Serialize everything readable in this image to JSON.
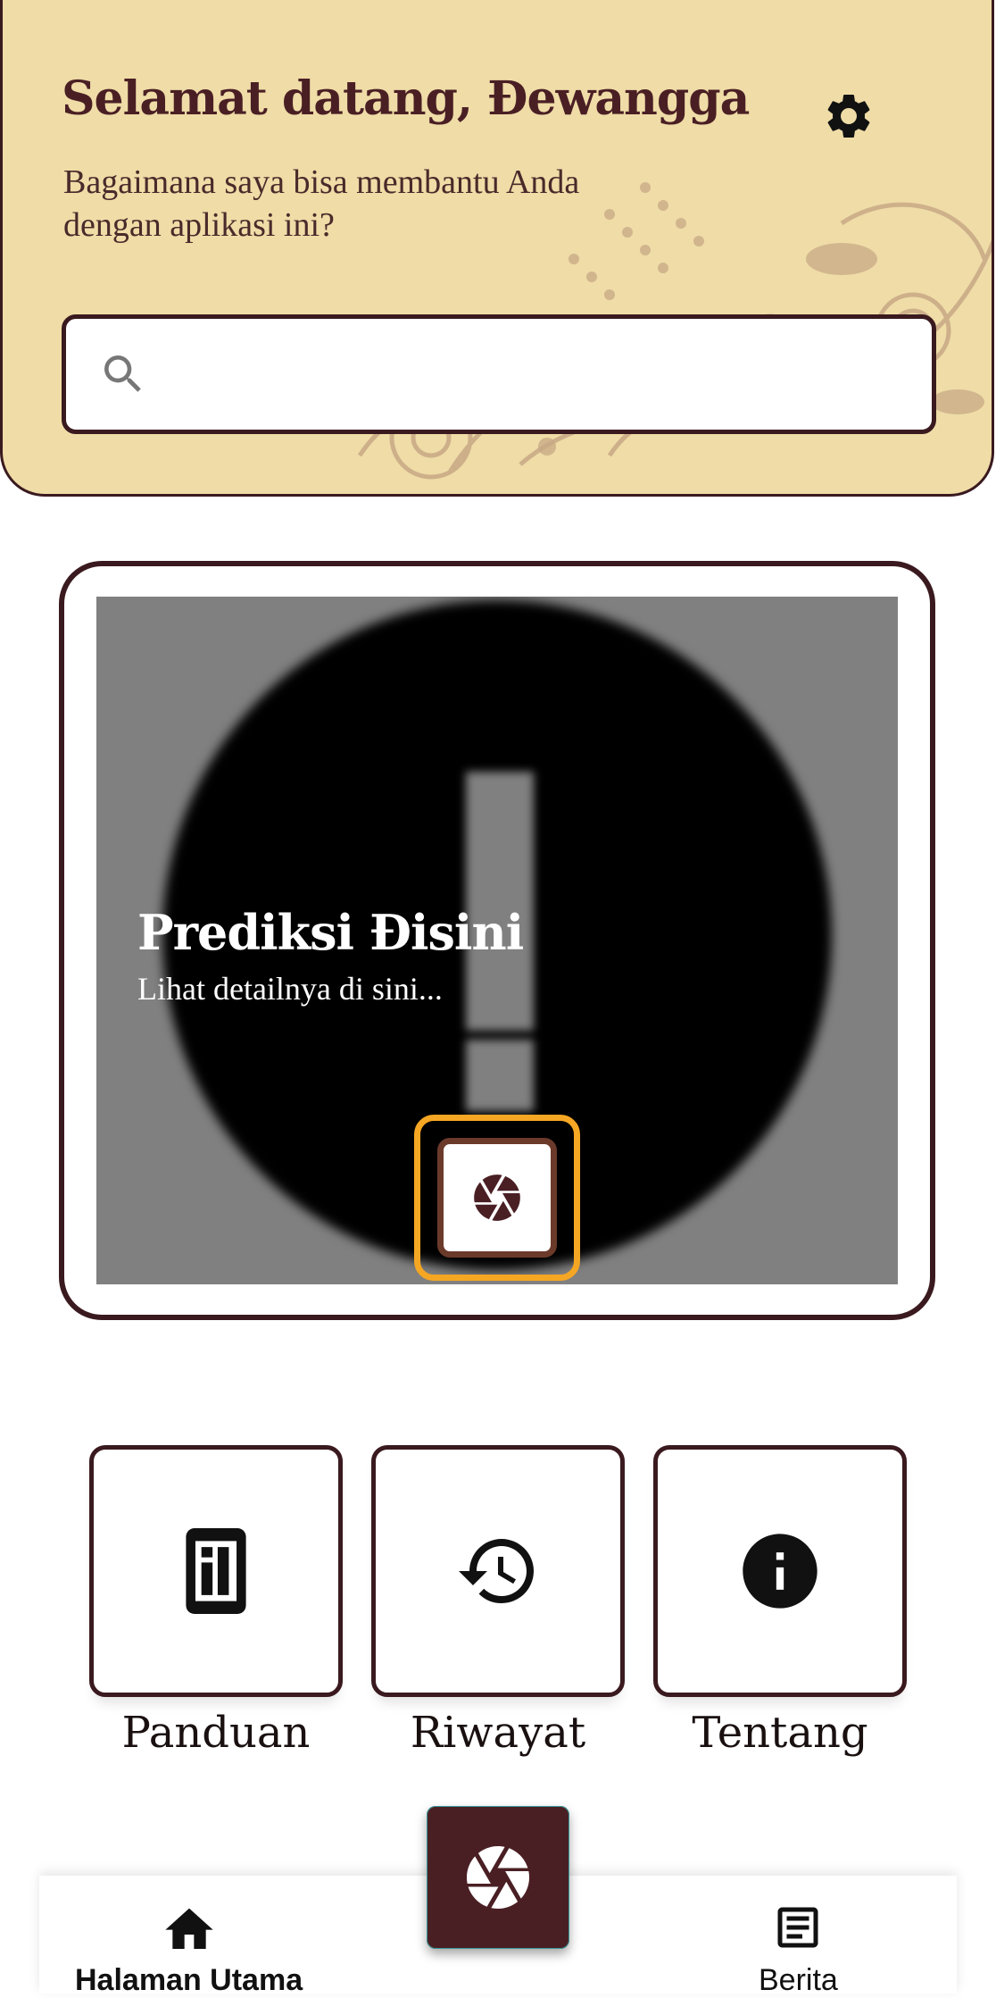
{
  "header": {
    "greeting": "Selamat datang, Đewangga",
    "subtitle": "Bagaimana saya bisa membantu Anda dengan aplikasi ini?",
    "settings_icon": "gear-icon"
  },
  "search": {
    "placeholder": "",
    "value": "",
    "icon": "search-icon"
  },
  "prediction": {
    "title": "Prediksi Đisini",
    "subtitle": "Lihat detailnya di sini...",
    "image_icon": "error-icon",
    "camera_icon": "camera-aperture-icon"
  },
  "menu": [
    {
      "label": "Panduan",
      "icon": "guide-icon"
    },
    {
      "label": "Riwayat",
      "icon": "history-icon"
    },
    {
      "label": "Tentang",
      "icon": "info-icon"
    }
  ],
  "bottom_nav": {
    "home_label": "Halaman Utama",
    "news_label": "Berita",
    "fab_icon": "camera-aperture-icon"
  },
  "colors": {
    "header_bg": "#efdca7",
    "primary_dark": "#4a1f24",
    "border": "#3a1a1f",
    "highlight": "#f5a623"
  }
}
